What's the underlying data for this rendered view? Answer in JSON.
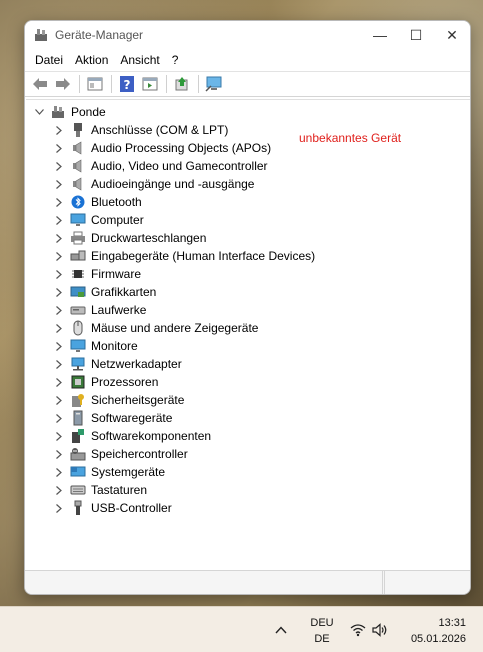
{
  "window": {
    "title": "Geräte-Manager",
    "controls": {
      "minimize": "—",
      "maximize": "☐",
      "close": "✕"
    }
  },
  "menu": [
    "Datei",
    "Aktion",
    "Ansicht",
    "?"
  ],
  "tree": {
    "root": "Ponde",
    "annotation": "unbekanntes Gerät",
    "items": [
      {
        "label": "Anschlüsse (COM & LPT)",
        "icon": "port-icon"
      },
      {
        "label": "Audio Processing Objects (APOs)",
        "icon": "speaker-icon"
      },
      {
        "label": "Audio, Video und Gamecontroller",
        "icon": "speaker-icon"
      },
      {
        "label": "Audioeingänge und -ausgänge",
        "icon": "speaker-icon"
      },
      {
        "label": "Bluetooth",
        "icon": "bluetooth-icon"
      },
      {
        "label": "Computer",
        "icon": "monitor-icon"
      },
      {
        "label": "Druckwarteschlangen",
        "icon": "printer-icon"
      },
      {
        "label": "Eingabegeräte (Human Interface Devices)",
        "icon": "hid-icon"
      },
      {
        "label": "Firmware",
        "icon": "chip-icon"
      },
      {
        "label": "Grafikkarten",
        "icon": "display-adapter-icon"
      },
      {
        "label": "Laufwerke",
        "icon": "drive-icon"
      },
      {
        "label": "Mäuse und andere Zeigegeräte",
        "icon": "mouse-icon"
      },
      {
        "label": "Monitore",
        "icon": "monitor-icon"
      },
      {
        "label": "Netzwerkadapter",
        "icon": "network-icon"
      },
      {
        "label": "Prozessoren",
        "icon": "processor-icon"
      },
      {
        "label": "Sicherheitsgeräte",
        "icon": "security-icon"
      },
      {
        "label": "Softwaregeräte",
        "icon": "software-device-icon"
      },
      {
        "label": "Softwarekomponenten",
        "icon": "software-component-icon"
      },
      {
        "label": "Speichercontroller",
        "icon": "storage-controller-icon"
      },
      {
        "label": "Systemgeräte",
        "icon": "system-icon"
      },
      {
        "label": "Tastaturen",
        "icon": "keyboard-icon"
      },
      {
        "label": "USB-Controller",
        "icon": "usb-icon"
      }
    ]
  },
  "taskbar": {
    "lang_line1": "DEU",
    "lang_line2": "DE",
    "time": "13:31",
    "date": "05.01.2026"
  }
}
